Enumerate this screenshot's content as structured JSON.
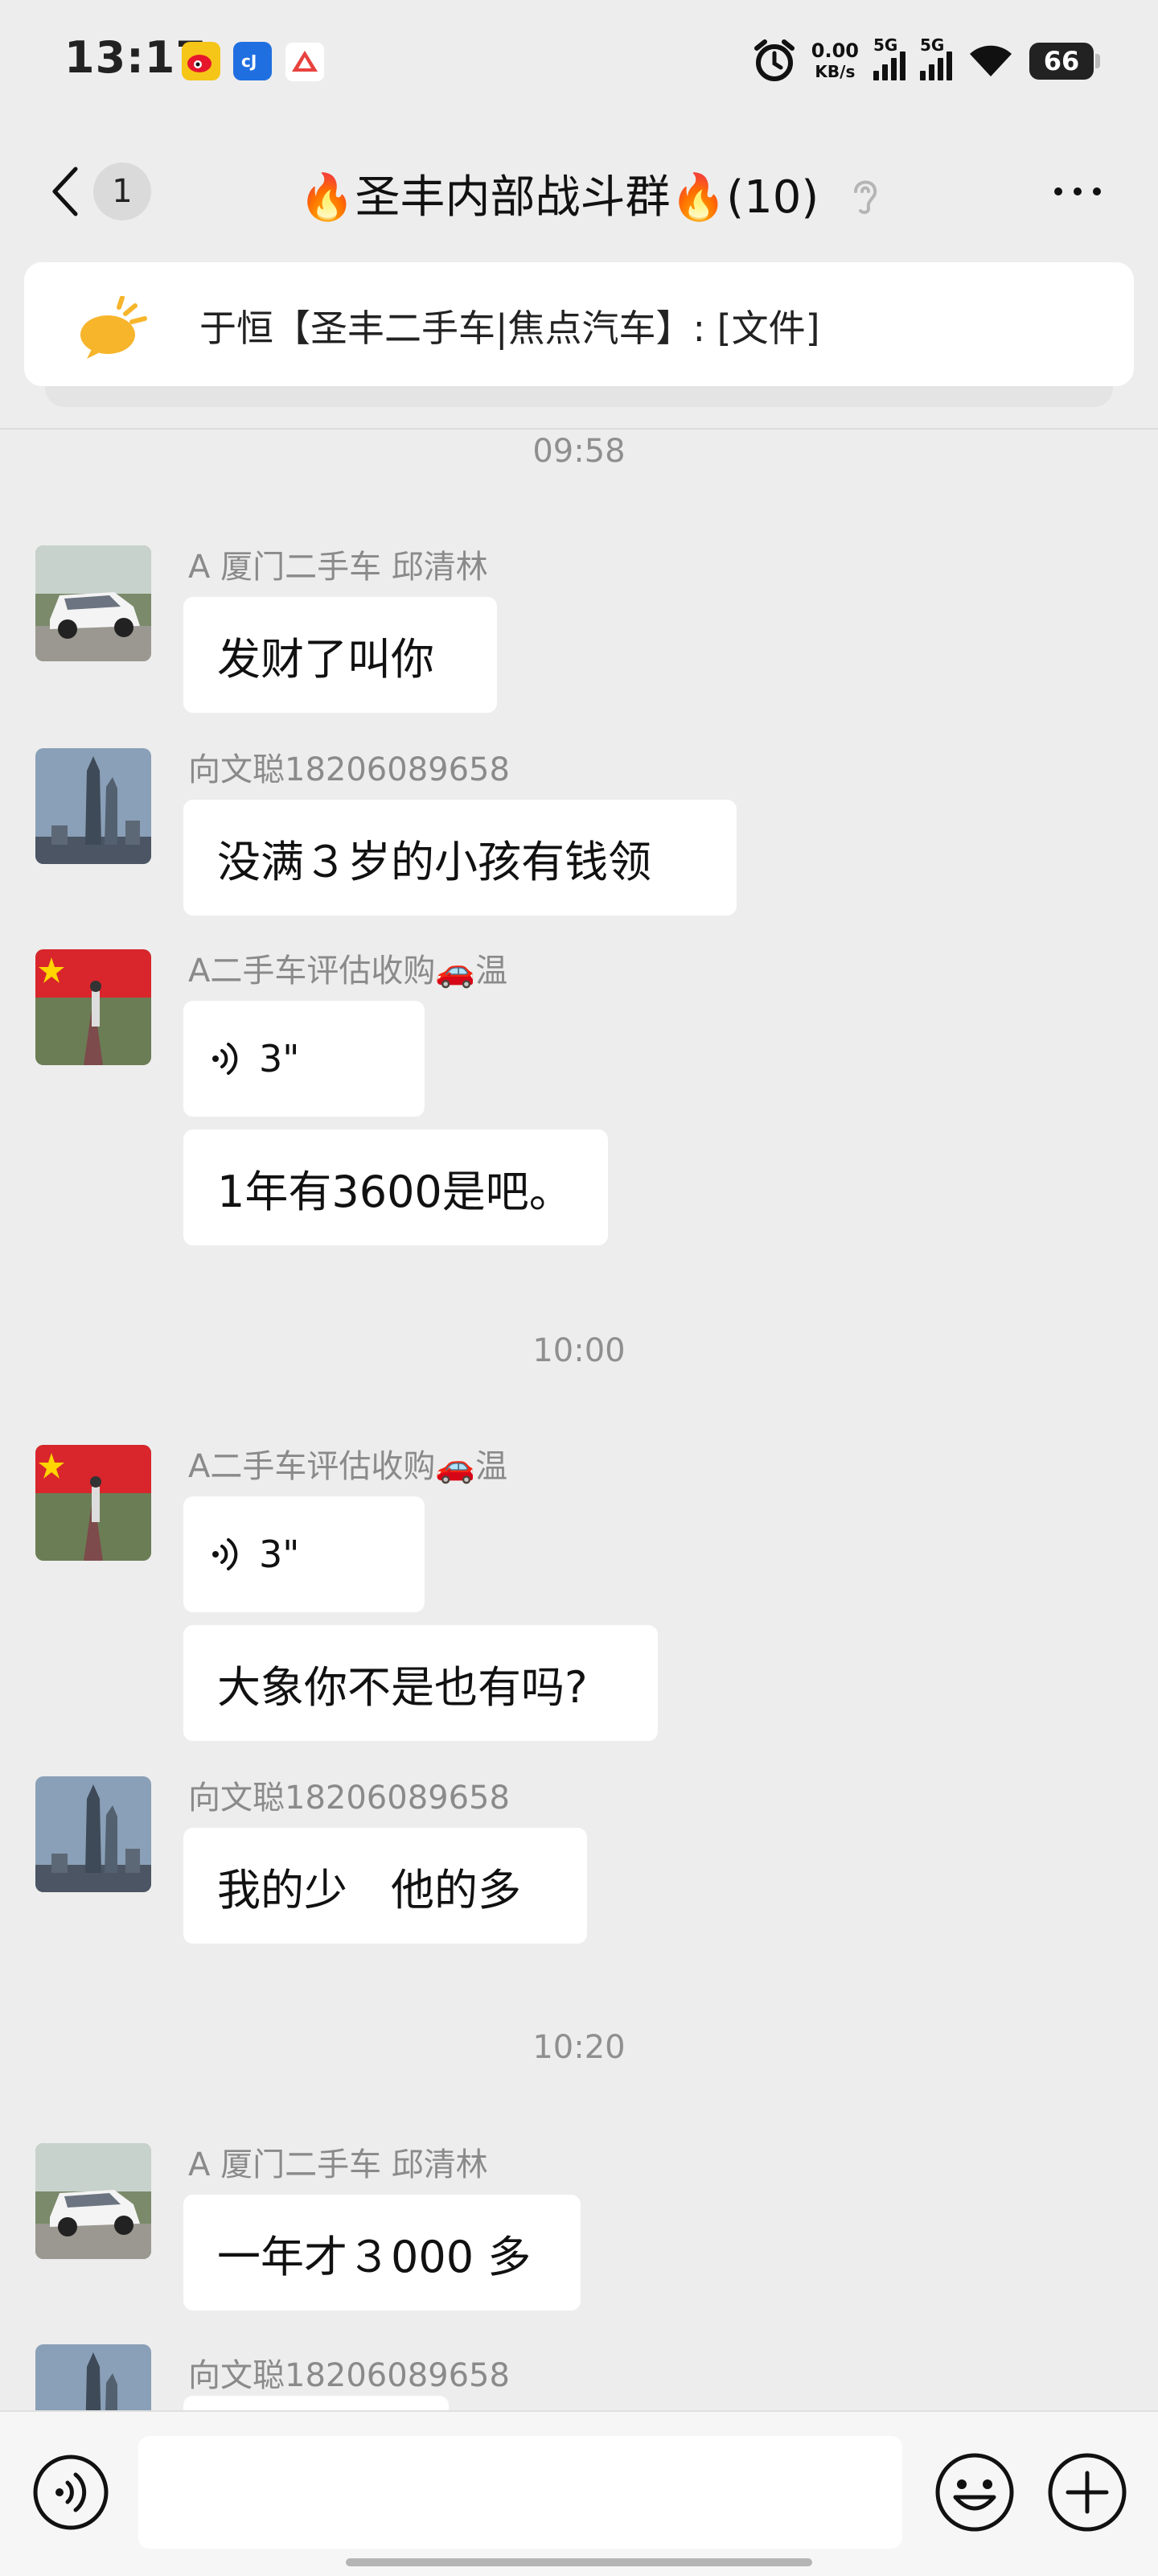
{
  "status_bar": {
    "time": "13:17",
    "net_speed_value": "0.00",
    "net_speed_unit": "KB/s",
    "signal1_label": "5G",
    "signal2_label": "5G",
    "battery_level": "66"
  },
  "header": {
    "unread_count": "1",
    "title": "🔥圣丰内部战斗群🔥(10)"
  },
  "pinned_notice": {
    "text": "于恒【圣丰二手车|焦点汽车】: [文件]"
  },
  "colors": {
    "background": "#ededed",
    "bubble": "#ffffff",
    "timestamp": "#8f8f8f",
    "sender": "#8a8a8a",
    "pin_icon": "#f7b52c"
  },
  "messages": [
    {
      "kind": "timestamp",
      "text": "09:58"
    },
    {
      "kind": "text",
      "sender": "A  厦门二手车  邱清林",
      "avatar": "white-car-avatar",
      "text": "发财了叫你"
    },
    {
      "kind": "text",
      "sender": "向文聪18206089658",
      "avatar": "skyscraper-avatar",
      "text": "没满３岁的小孩有钱领"
    },
    {
      "kind": "voice",
      "sender": "A二手车评估收购🚗温",
      "avatar": "flag-avatar",
      "duration": "3\""
    },
    {
      "kind": "text",
      "text": "1年有3600是吧。"
    },
    {
      "kind": "timestamp",
      "text": "10:00"
    },
    {
      "kind": "voice",
      "sender": "A二手车评估收购🚗温",
      "avatar": "flag-avatar",
      "duration": "3\""
    },
    {
      "kind": "text",
      "text": "大象你不是也有吗?"
    },
    {
      "kind": "text",
      "sender": "向文聪18206089658",
      "avatar": "skyscraper-avatar",
      "text": "我的少　他的多"
    },
    {
      "kind": "timestamp",
      "text": "10:20"
    },
    {
      "kind": "text",
      "sender": "A  厦门二手车  邱清林",
      "avatar": "white-car-avatar",
      "text": "一年才３000 多"
    },
    {
      "kind": "text",
      "sender": "向文聪18206089658",
      "avatar": "skyscraper-avatar",
      "text": ""
    }
  ],
  "input_bar": {
    "placeholder": ""
  }
}
